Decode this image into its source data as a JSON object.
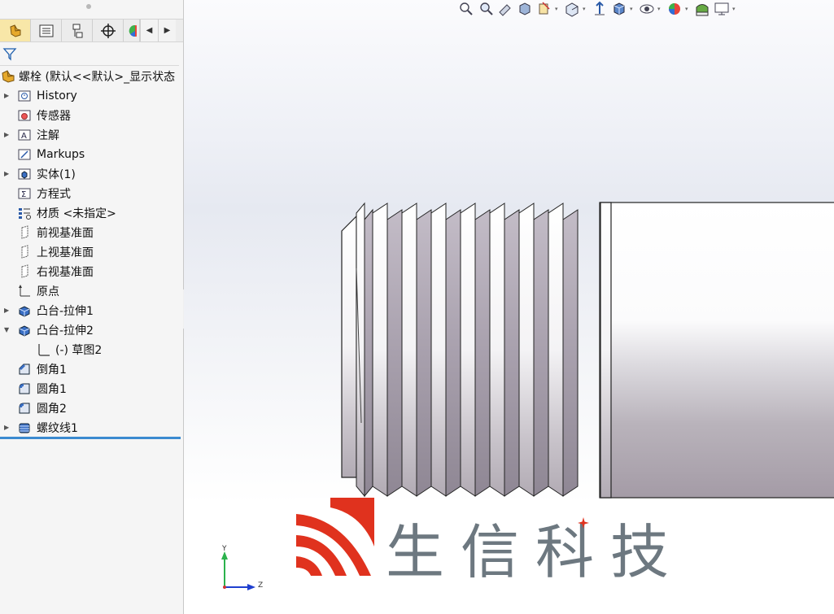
{
  "feature_tree": {
    "tabs": [
      {
        "name": "featuremanager-tab",
        "active": true
      },
      {
        "name": "propertymanager-tab",
        "active": false
      },
      {
        "name": "configurationmanager-tab",
        "active": false
      },
      {
        "name": "dimxpert-tab",
        "active": false
      },
      {
        "name": "appearance-tab",
        "active": false
      }
    ],
    "root_label": "螺栓  (默认<<默认>_显示状态",
    "items": [
      {
        "label": "History",
        "icon": "history-folder-icon",
        "expandable": true
      },
      {
        "label": "传感器",
        "icon": "sensors-folder-icon",
        "expandable": false
      },
      {
        "label": "注解",
        "icon": "annotations-folder-icon",
        "expandable": true
      },
      {
        "label": "Markups",
        "icon": "markups-folder-icon",
        "expandable": false
      },
      {
        "label": "实体(1)",
        "icon": "solid-bodies-folder-icon",
        "expandable": true
      },
      {
        "label": "方程式",
        "icon": "equations-folder-icon",
        "expandable": false
      },
      {
        "label": "材质 <未指定>",
        "icon": "material-icon",
        "expandable": false
      },
      {
        "label": "前视基准面",
        "icon": "plane-icon",
        "expandable": false
      },
      {
        "label": "上视基准面",
        "icon": "plane-icon",
        "expandable": false
      },
      {
        "label": "右视基准面",
        "icon": "plane-icon",
        "expandable": false
      },
      {
        "label": "原点",
        "icon": "origin-icon",
        "expandable": false
      },
      {
        "label": "凸台-拉伸1",
        "icon": "boss-extrude-icon",
        "expandable": true
      },
      {
        "label": "凸台-拉伸2",
        "icon": "boss-extrude-icon",
        "expanded": true
      },
      {
        "label": "(-) 草图2",
        "icon": "sketch-icon",
        "child": true
      },
      {
        "label": "倒角1",
        "icon": "chamfer-icon",
        "expandable": false
      },
      {
        "label": "圆角1",
        "icon": "fillet-icon",
        "expandable": false
      },
      {
        "label": "圆角2",
        "icon": "fillet-icon",
        "expandable": false
      },
      {
        "label": "螺纹线1",
        "icon": "thread-icon",
        "expandable": true
      }
    ]
  },
  "viewport": {
    "toolbar_icons": [
      "zoom-to-fit-icon",
      "zoom-to-area-icon",
      "previous-view-icon",
      "section-view-icon",
      "dynamic-annotation-icon",
      "view-orientation-icon",
      "display-style-icon",
      "hide-show-items-icon",
      "edit-appearance-icon",
      "apply-scene-icon",
      "view-settings-icon",
      "display-monitor-icon"
    ],
    "watermark_text": "生信科技",
    "triad": {
      "y_label": "Y",
      "z_label": "Z"
    }
  },
  "colors": {
    "thread_groove": "#a8a0ad",
    "selection_line": "#3b8ad0",
    "logo_red": "#e0321e",
    "logo_gray": "#6d7880",
    "triad_y": "#2bb24c",
    "triad_z": "#1f3fcf"
  }
}
